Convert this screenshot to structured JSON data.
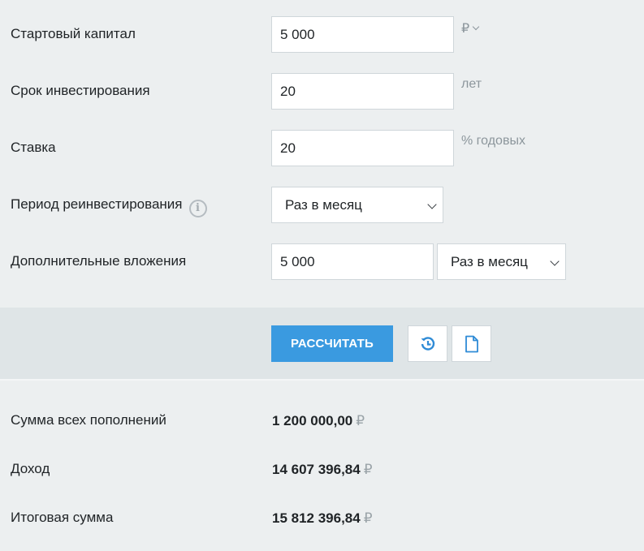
{
  "form": {
    "start_capital": {
      "label": "Стартовый капитал",
      "value": "5 000",
      "unit": "₽"
    },
    "term": {
      "label": "Срок инвестирования",
      "value": "20",
      "unit": "лет"
    },
    "rate": {
      "label": "Ставка",
      "value": "20",
      "unit": "% годовых"
    },
    "reinvest": {
      "label": "Период реинвестирования",
      "info": "i",
      "selected": "Раз в месяц"
    },
    "additional": {
      "label": "Дополнительные вложения",
      "value": "5 000",
      "period_selected": "Раз в месяц"
    }
  },
  "actions": {
    "calculate_label": "РАССЧИТАТЬ",
    "reset_icon": "history-reset-icon",
    "document_icon": "document-icon"
  },
  "results": {
    "deposits": {
      "label": "Сумма всех пополнений",
      "value": "1 200 000,00",
      "currency": "₽"
    },
    "income": {
      "label": "Доход",
      "value": "14 607 396,84",
      "currency": "₽"
    },
    "total": {
      "label": "Итоговая сумма",
      "value": "15 812 396,84",
      "currency": "₽"
    }
  },
  "colors": {
    "accent": "#3a9ae0",
    "background": "#eceff0",
    "toolbar": "#dfe5e7"
  }
}
